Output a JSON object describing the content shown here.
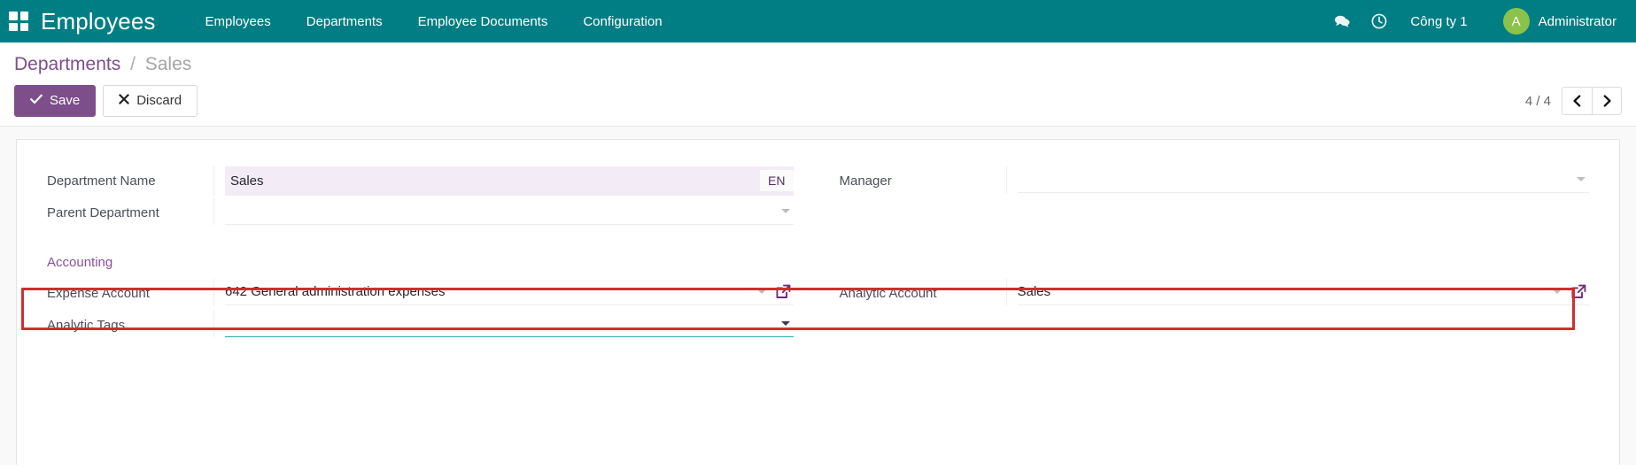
{
  "navbar": {
    "apps_icon": "apps-grid-icon",
    "brand": "Employees",
    "menu": [
      {
        "label": "Employees"
      },
      {
        "label": "Departments"
      },
      {
        "label": "Employee Documents"
      },
      {
        "label": "Configuration"
      }
    ],
    "messages_icon": "chat-bubble-icon",
    "activities_icon": "clock-icon",
    "company": "Công ty 1",
    "avatar_initial": "A",
    "user": "Administrator",
    "bg_color": "#017e84"
  },
  "control_panel": {
    "breadcrumb_root": "Departments",
    "breadcrumb_sep": "/",
    "breadcrumb_current": "Sales",
    "save_label": "Save",
    "discard_label": "Discard",
    "save_icon": "check-icon",
    "discard_icon": "close-x-icon",
    "pager_count": "4 / 4",
    "pager_prev_icon": "chevron-left-icon",
    "pager_next_icon": "chevron-right-icon",
    "accent_color": "#7d4e8a"
  },
  "form": {
    "department_name_label": "Department Name",
    "department_name_value": "Sales",
    "language_badge": "EN",
    "parent_department_label": "Parent Department",
    "parent_department_value": "",
    "manager_label": "Manager",
    "manager_value": "",
    "accounting_section": "Accounting",
    "expense_account_label": "Expense Account",
    "expense_account_value": "642 General administration expenses",
    "analytic_account_label": "Analytic Account",
    "analytic_account_value": "Sales",
    "analytic_tags_label": "Analytic Tags",
    "analytic_tags_value": "",
    "dropdown_icon": "chevron-down-caret-icon",
    "internal_link_icon": "external-link-icon",
    "highlight_color": "#cf2e2e"
  }
}
